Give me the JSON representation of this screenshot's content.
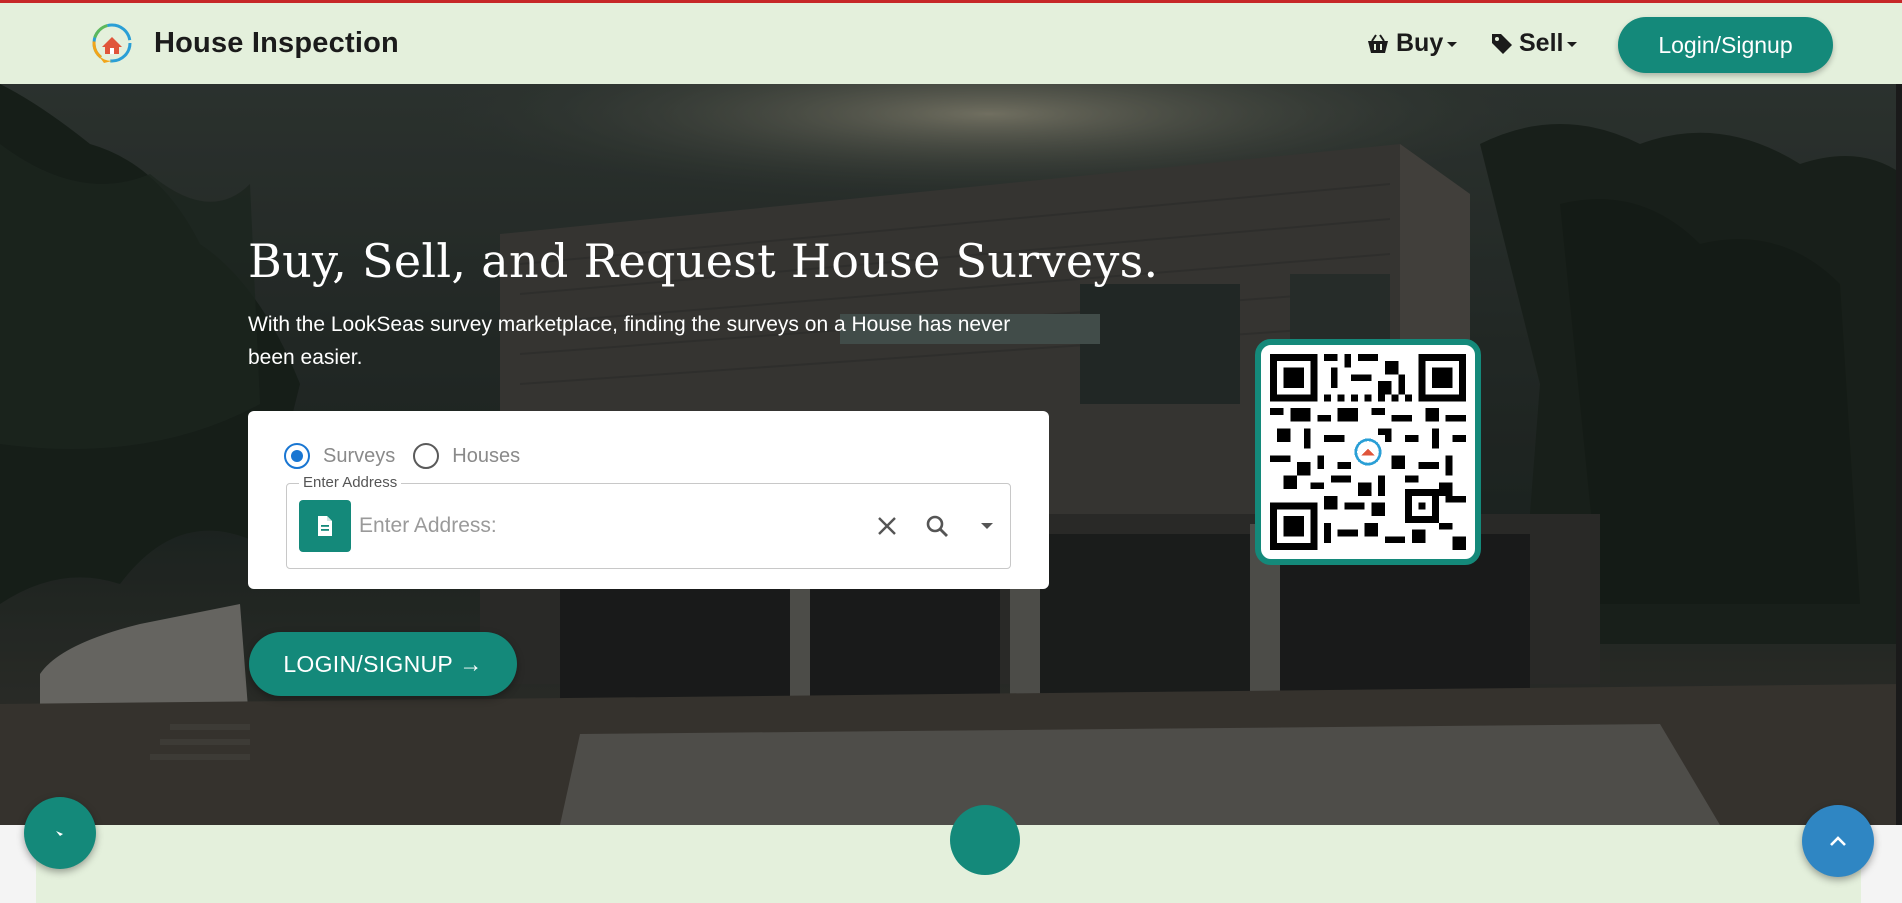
{
  "navbar": {
    "brand": "House Inspection",
    "buy_label": "Buy",
    "sell_label": "Sell",
    "login_label": "Login/Signup"
  },
  "hero": {
    "title": "Buy, Sell, and Request House Surveys.",
    "subtitle": "With the LookSeas survey marketplace, finding the surveys on a House has never been easier.",
    "cta_label": "LOGIN/SIGNUP"
  },
  "search": {
    "options": [
      "Surveys",
      "Houses"
    ],
    "selected": "Surveys",
    "field_label": "Enter Address",
    "placeholder": "Enter Address:",
    "value": ""
  },
  "colors": {
    "brand_green": "#14897a",
    "nav_bg": "#e4f0dc",
    "radio_blue": "#1976d2",
    "scroll_top_blue": "#2f86c3"
  },
  "icons": {
    "buy": "basket-icon",
    "sell": "tag-icon",
    "document": "document-icon",
    "clear": "close-icon",
    "search": "search-icon",
    "dropdown": "chevron-down-icon",
    "scroll_top": "chevron-up-icon"
  }
}
